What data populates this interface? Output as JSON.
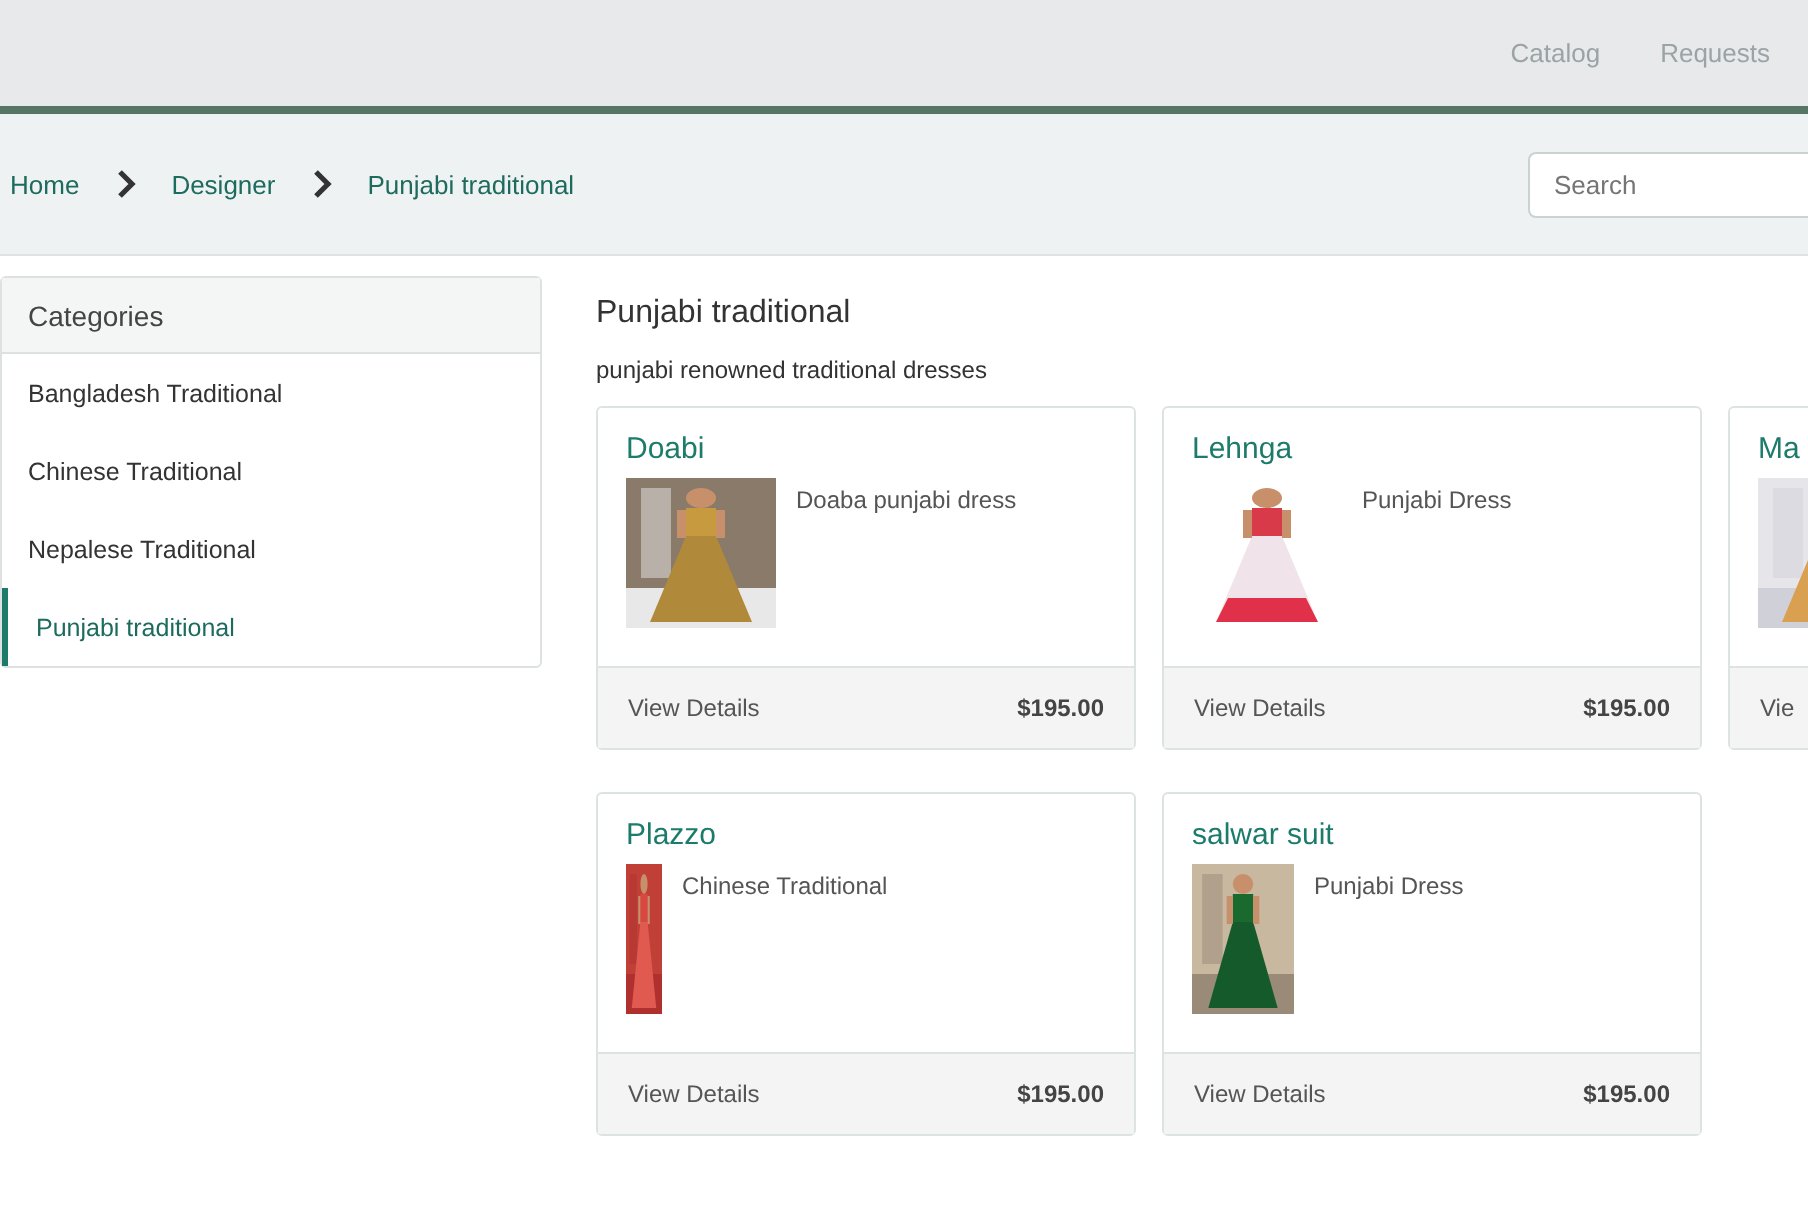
{
  "nav": [
    {
      "label": "Catalog"
    },
    {
      "label": "Requests"
    }
  ],
  "breadcrumb": [
    {
      "label": "Home"
    },
    {
      "label": "Designer"
    },
    {
      "label": "Punjabi traditional"
    }
  ],
  "search": {
    "placeholder": "Search"
  },
  "sidebar": {
    "title": "Categories",
    "items": [
      {
        "label": "Bangladesh Traditional",
        "selected": false
      },
      {
        "label": "Chinese Traditional",
        "selected": false
      },
      {
        "label": "Nepalese Traditional",
        "selected": false
      },
      {
        "label": "Punjabi traditional",
        "selected": true
      }
    ]
  },
  "category": {
    "title": "Punjabi traditional",
    "description": "punjabi renowned traditional dresses"
  },
  "products": [
    {
      "name": "Doabi",
      "description": "Doaba punjabi dress",
      "link": "View Details",
      "price": "$195.00"
    },
    {
      "name": "Lehnga",
      "description": "Punjabi Dress",
      "link": "View Details",
      "price": "$195.00"
    },
    {
      "name": "Ma",
      "link": "Vie"
    },
    {
      "name": "Plazzo",
      "description": "Chinese Traditional",
      "link": "View Details",
      "price": "$195.00"
    },
    {
      "name": "salwar suit",
      "description": "Punjabi Dress",
      "link": "View Details",
      "price": "$195.00"
    }
  ]
}
